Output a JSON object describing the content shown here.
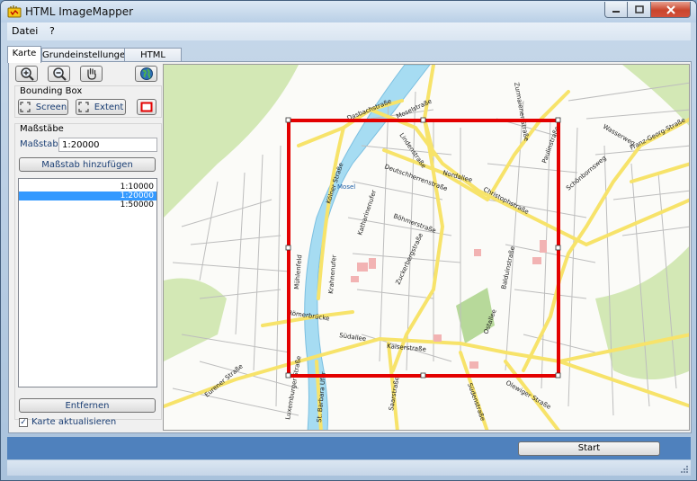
{
  "window": {
    "title": "HTML ImageMapper"
  },
  "menu": [
    "Datei",
    "?"
  ],
  "tabs": [
    "Karte",
    "Grundeinstellungen",
    "HTML Export"
  ],
  "bounding_box": {
    "label": "Bounding Box",
    "screen_button": "Screen",
    "extent_button": "Extent"
  },
  "scales": {
    "label": "Maßstäbe",
    "field_label": "Maßstab:",
    "field_value": "1:20000",
    "add_button": "Maßstab hinzufügen",
    "items": [
      "1:10000",
      "1:20000",
      "1:50000"
    ],
    "selected_index": 1,
    "remove_button": "Entfernen"
  },
  "refresh_map": {
    "label": "Karte aktualisieren",
    "checked": true
  },
  "start_button": "Start",
  "map": {
    "river_label": "Mosel",
    "street_labels": [
      "Dasbachstraße",
      "Moselstraße",
      "Zurmaiener Straße",
      "Schönbornsweg",
      "Franz-Georg-Straße",
      "Wasserweg",
      "Paulinstraße",
      "Lindenstraße",
      "Nordallee",
      "Deutschherrenstraße",
      "Christophstraße",
      "Katharinenufer",
      "Kölner Straße",
      "Mühlenfeld",
      "Böhmerstraße",
      "Zuckerbergstraße",
      "Krahnenufer",
      "Balduinstraße",
      "Ostallee",
      "Römerbrücke",
      "Südallee",
      "Kaiserstraße",
      "Luxemburger Straße",
      "Eurener Straße",
      "St. Barbara Ufer",
      "Saarstraße",
      "Südenstraße",
      "Olewiger Straße"
    ]
  },
  "colors": {
    "accent_blue": "#4f81bd",
    "selection_blue": "#3399ff",
    "bbox_red": "#e30000",
    "river": "#a6dcf2",
    "road_yellow": "#f7e36a",
    "park_green": "#d3e8b5"
  }
}
